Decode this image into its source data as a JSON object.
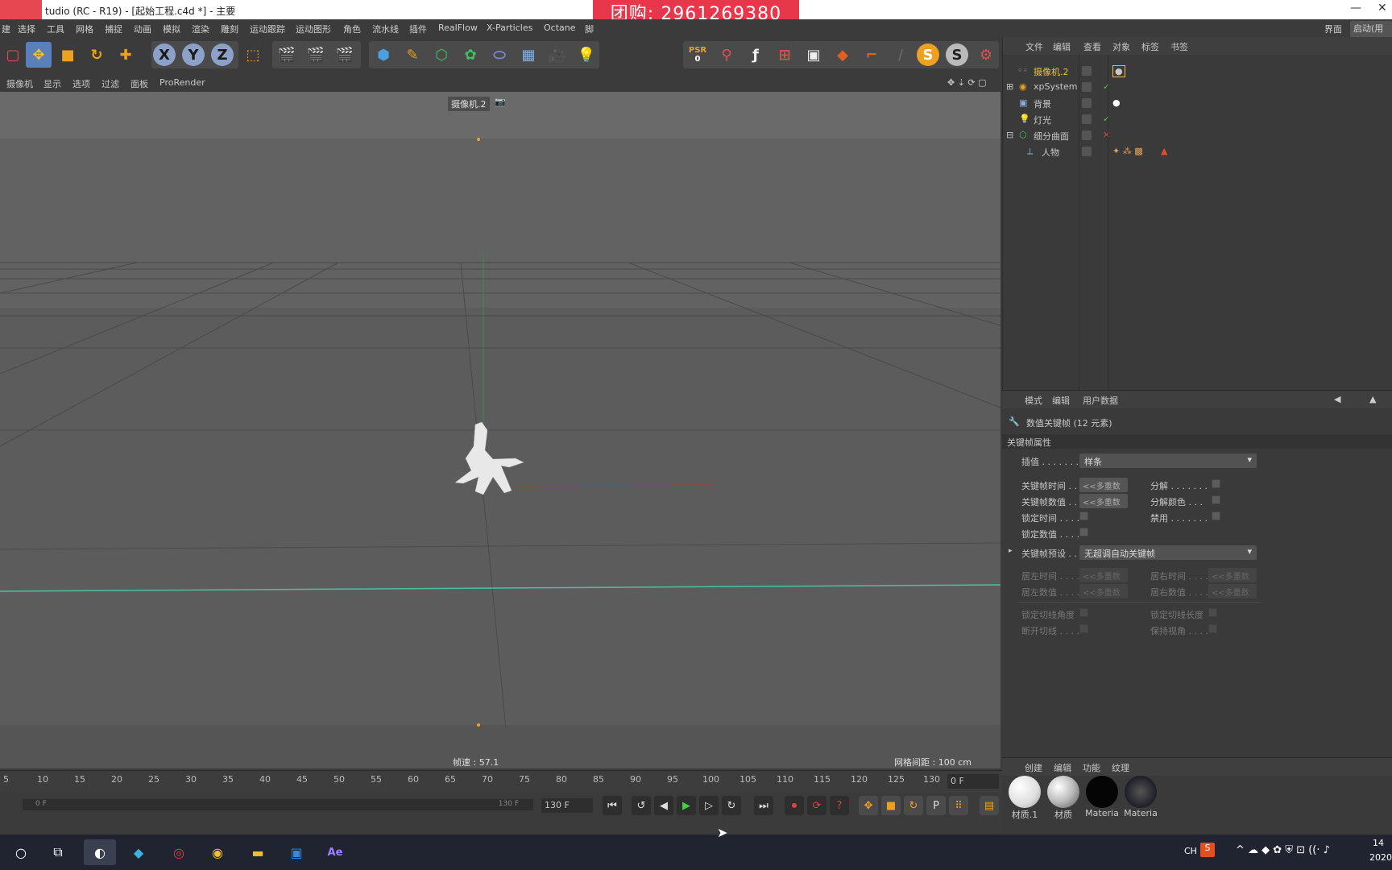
{
  "titlebar": {
    "title": "tudio (RC - R19) - [起始工程.c4d *] - 主要",
    "minimize": "—",
    "close": "✕"
  },
  "promo": {
    "text": "团购:  2961269380"
  },
  "menubar": {
    "items": [
      "建",
      "选择",
      "工具",
      "网格",
      "捕捉",
      "动画",
      "模拟",
      "渲染",
      "雕刻",
      "运动跟踪",
      "运动图形",
      "角色",
      "流水线",
      "插件",
      "RealFlow",
      "X-Particles",
      "Octane",
      "脚"
    ],
    "right_label": "界面",
    "right_select": "启动(用户"
  },
  "toolbar": {
    "axis_x": "X",
    "axis_y": "Y",
    "axis_z": "Z",
    "psr_label": "PSR",
    "psr_value": "0",
    "s1": "S",
    "s2": "S"
  },
  "viewport_menu": {
    "items": [
      "摄像机",
      "显示",
      "选项",
      "过滤",
      "面板",
      "ProRender"
    ]
  },
  "viewport": {
    "camera_label": "摄像机.2",
    "fps": "帧速 : 57.1",
    "grid_spacing": "网格间距 : 100 cm"
  },
  "timeline": {
    "ticks": [
      "5",
      "10",
      "15",
      "20",
      "25",
      "30",
      "35",
      "40",
      "45",
      "50",
      "55",
      "60",
      "65",
      "70",
      "75",
      "80",
      "85",
      "90",
      "95",
      "100",
      "105",
      "110",
      "115",
      "120",
      "125",
      "130"
    ],
    "current_frame": "0 F"
  },
  "transport": {
    "range_start": "0 F",
    "range_end": "130 F",
    "end_field": "130 F"
  },
  "object_manager": {
    "menu": [
      "文件",
      "编辑",
      "查看",
      "对象",
      "标签",
      "书签"
    ],
    "objects": [
      {
        "name": "摄像机.2",
        "color": "#f0c040"
      },
      {
        "name": "xpSystem",
        "color": "#c8c8c8"
      },
      {
        "name": "背景",
        "color": "#c8c8c8"
      },
      {
        "name": "灯光",
        "color": "#c8c8c8"
      },
      {
        "name": "细分曲面",
        "color": "#c8c8c8"
      },
      {
        "name": "人物",
        "color": "#c8c8c8"
      }
    ]
  },
  "attributes": {
    "menu": [
      "模式",
      "编辑",
      "用户数据"
    ],
    "header": "数值关键帧 (12 元素)",
    "section": "关键帧属性",
    "interp_label": "插值 . . . . . . .",
    "interp_value": "样条",
    "key_time": "关键帧时间 . .",
    "key_value": "关键帧数值 . .",
    "multi": "<<多重数",
    "split": "分解 . . . . . . .",
    "split_color": "分解颜色 . . .",
    "lock_time": "锁定时间 . . . .",
    "disable": "禁用 . . . . . . .",
    "lock_value": "锁定数值 . . . .",
    "preset_label": "关键帧预设 . .",
    "preset_value": "无超调自动关键帧",
    "left_time": "居左时间 . . . .",
    "right_time": "居右时间 . . . .",
    "left_value": "居左数值 . . . .",
    "right_value": "居右数值 . . . .",
    "lock_tangent_angle": "锁定切线角度",
    "lock_tangent_len": "锁定切线长度",
    "break_tangent": "断开切线 . . . .",
    "keep_visual": "保持视角 . . . ."
  },
  "materials": {
    "menu": [
      "创建",
      "编辑",
      "功能",
      "纹理"
    ],
    "items": [
      {
        "name": "材质.1",
        "color": "#f4f4f4"
      },
      {
        "name": "材质",
        "color": "#d8d8d8"
      },
      {
        "name": "Materia",
        "color": "#050505"
      },
      {
        "name": "Materia",
        "color": "#2a2a34"
      }
    ]
  },
  "taskbar": {
    "lang": "CH",
    "time": "14",
    "date": "2020"
  }
}
